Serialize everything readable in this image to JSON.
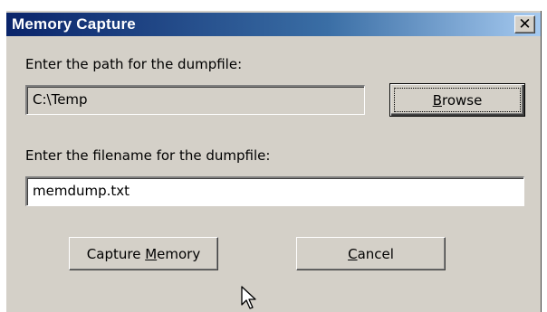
{
  "window": {
    "title": "Memory Capture",
    "close_glyph": "✕"
  },
  "path_section": {
    "label": "Enter the path for the dumpfile:",
    "value": "C:\\Temp",
    "browse_prefix": "",
    "browse_mnemonic": "B",
    "browse_suffix": "rowse"
  },
  "filename_section": {
    "label": "Enter the filename for the dumpfile:",
    "value": "memdump.txt"
  },
  "buttons": {
    "capture_prefix": "Capture ",
    "capture_mnemonic": "M",
    "capture_suffix": "emory",
    "cancel_prefix": "",
    "cancel_mnemonic": "C",
    "cancel_suffix": "ancel"
  },
  "colors": {
    "dialog_face": "#d4d0c8",
    "titlebar_start": "#0a246a",
    "titlebar_end": "#a6caf0"
  }
}
